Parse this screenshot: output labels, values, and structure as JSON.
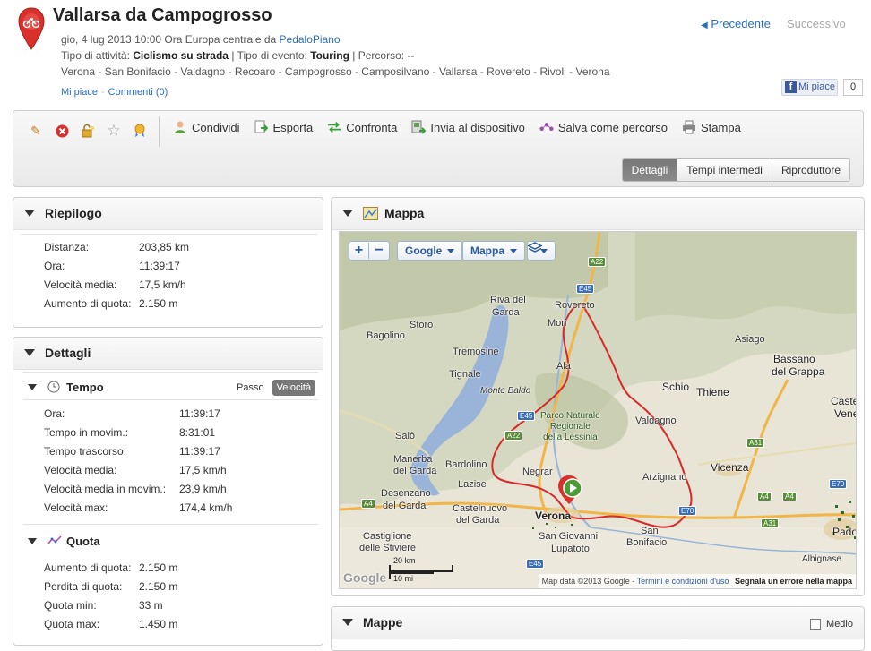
{
  "header": {
    "title": "Vallarsa da Campogrosso",
    "meta_date": "gio, 4 lug 2013 10:00 Ora Europa centrale da",
    "author": "PedaloPiano",
    "activity_label": "Tipo di attività:",
    "activity_value": "Ciclismo su strada",
    "event_label": "| Tipo di evento:",
    "event_value": "Touring",
    "route_label": "| Percorso: --",
    "route_summary": "Verona - San Bonifacio - Valdagno - Recoaro - Campogrosso - Camposilvano - Vallarsa - Rovereto - Rivoli - Verona",
    "like_link": "Mi piace",
    "comments_link": "Commenti (0)",
    "nav_prev": "Precedente",
    "nav_next": "Successivo",
    "fb_like": "Mi piace",
    "fb_count": "0"
  },
  "toolbar": {
    "share": "Condividi",
    "export": "Esporta",
    "compare": "Confronta",
    "send": "Invia al dispositivo",
    "save_route": "Salva come percorso",
    "print": "Stampa",
    "tabs": [
      "Dettagli",
      "Tempi intermedi",
      "Riproduttore"
    ]
  },
  "summary": {
    "title": "Riepilogo",
    "rows": [
      {
        "k": "Distanza:",
        "v": "203,85 km"
      },
      {
        "k": "Ora:",
        "v": "11:39:17"
      },
      {
        "k": "Velocità media:",
        "v": "17,5 km/h"
      },
      {
        "k": "Aumento di quota:",
        "v": "2.150 m"
      }
    ]
  },
  "details": {
    "title": "Dettagli",
    "time": {
      "title": "Tempo",
      "toggle": [
        "Passo",
        "Velocità"
      ],
      "rows": [
        {
          "k": "Ora:",
          "v": "11:39:17"
        },
        {
          "k": "Tempo in movim.:",
          "v": "8:31:01"
        },
        {
          "k": "Tempo trascorso:",
          "v": "11:39:17"
        },
        {
          "k": "Velocità media:",
          "v": "17,5 km/h"
        },
        {
          "k": "Velocità media in movim.:",
          "v": "23,9 km/h"
        },
        {
          "k": "Velocità max:",
          "v": "174,4 km/h"
        }
      ]
    },
    "elevation": {
      "title": "Quota",
      "rows": [
        {
          "k": "Aumento di quota:",
          "v": "2.150 m"
        },
        {
          "k": "Perdita di quota:",
          "v": "2.150 m"
        },
        {
          "k": "Quota min:",
          "v": "33 m"
        },
        {
          "k": "Quota max:",
          "v": "1.450 m"
        }
      ]
    }
  },
  "map_panel": {
    "title": "Mappa",
    "provider": "Google",
    "type": "Mappa",
    "labels": {
      "rovereto": "Rovereto",
      "riva": "Riva del",
      "garda1": "Garda",
      "storo": "Storo",
      "mori": "Mori",
      "bagolino": "Bagolino",
      "tremosine": "Tremosine",
      "tignale": "Tignale",
      "monte_baldo": "Monte Baldo",
      "ala": "Ala",
      "schio": "Schio",
      "thiene": "Thiene",
      "asiago": "Asiago",
      "bassano": "Bassano",
      "del_grappa": "del Grappa",
      "castelfranco": "Caste",
      "veneto": "Vene",
      "park": "Parco Naturale\nRegionale\ndella Lessinia",
      "valdagno": "Valdagno",
      "salo": "Salò",
      "manerba": "Manerba",
      "del_garda2": "del Garda",
      "bardolino": "Bardolino",
      "lazise": "Lazise",
      "negrar": "Negrar",
      "arzignano": "Arzignano",
      "vicenza": "Vicenza",
      "desenzano": "Desenzano",
      "del_garda3": "del Garda",
      "verona": "Verona",
      "castelnuovo": "Castelnuovo",
      "del_garda4": "del Garda",
      "san_giovanni": "San Giovanni",
      "lupatoto": "Lupatoto",
      "san": "San",
      "bonifacio": "Bonifacio",
      "castiglione": "Castiglione",
      "stiviere": "delle Stiviere",
      "padova": "Pado",
      "albignasego": "Albignase",
      "roads": [
        "A22",
        "E45",
        "E45",
        "A22",
        "A31",
        "A31",
        "A4",
        "E70",
        "A4",
        "A4",
        "E70",
        "E45"
      ]
    },
    "scale_km": "20 km",
    "scale_mi": "10 mi",
    "footer_data": "Map data ©2013 Google -",
    "footer_terms": "Termini e condizioni d'uso",
    "footer_report": "Segnala un errore nella mappa",
    "google_logo": "Google"
  },
  "maps_panel": {
    "title": "Mappe",
    "medio": "Medio"
  }
}
